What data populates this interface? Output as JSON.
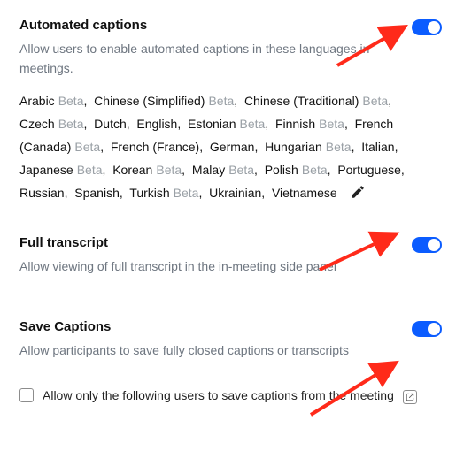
{
  "beta_label": "Beta",
  "sections": {
    "automated": {
      "title": "Automated captions",
      "desc": "Allow users to enable automated captions in these languages in meetings.",
      "enabled": true
    },
    "transcript": {
      "title": "Full transcript",
      "desc": "Allow viewing of full transcript in the in-meeting side panel",
      "enabled": true
    },
    "save": {
      "title": "Save Captions",
      "desc": "Allow participants to save fully closed captions or transcripts",
      "enabled": true,
      "restrict_checkbox": {
        "checked": false,
        "label": "Allow only the following users to save captions from the meeting"
      }
    }
  },
  "languages": [
    {
      "name": "Arabic",
      "beta": true
    },
    {
      "name": "Chinese (Simplified)",
      "beta": true
    },
    {
      "name": "Chinese (Traditional)",
      "beta": true
    },
    {
      "name": "Czech",
      "beta": true
    },
    {
      "name": "Dutch",
      "beta": false
    },
    {
      "name": "English",
      "beta": false
    },
    {
      "name": "Estonian",
      "beta": true
    },
    {
      "name": "Finnish",
      "beta": true
    },
    {
      "name": "French (Canada)",
      "beta": true
    },
    {
      "name": "French (France)",
      "beta": false
    },
    {
      "name": "German",
      "beta": false
    },
    {
      "name": "Hungarian",
      "beta": true
    },
    {
      "name": "Italian",
      "beta": false
    },
    {
      "name": "Japanese",
      "beta": true
    },
    {
      "name": "Korean",
      "beta": true
    },
    {
      "name": "Malay",
      "beta": true
    },
    {
      "name": "Polish",
      "beta": true
    },
    {
      "name": "Portuguese",
      "beta": false
    },
    {
      "name": "Russian",
      "beta": false
    },
    {
      "name": "Spanish",
      "beta": false
    },
    {
      "name": "Turkish",
      "beta": true
    },
    {
      "name": "Ukrainian",
      "beta": false
    },
    {
      "name": "Vietnamese",
      "beta": false
    }
  ],
  "colors": {
    "accent": "#0b5cff",
    "arrow": "#ff2a1a",
    "muted": "#6e7680"
  }
}
